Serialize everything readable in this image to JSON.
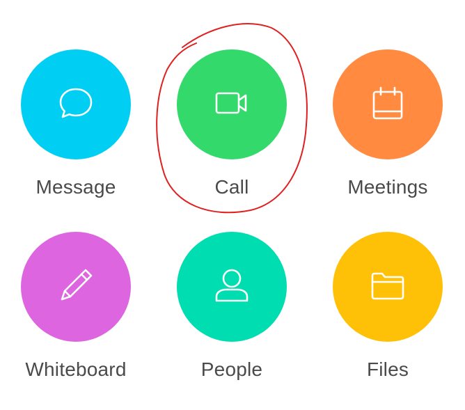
{
  "tiles": [
    {
      "label": "Message",
      "icon": "chat-bubble-icon",
      "color": "#00CFF3"
    },
    {
      "label": "Call",
      "icon": "video-camera-icon",
      "color": "#34D96B"
    },
    {
      "label": "Meetings",
      "icon": "calendar-icon",
      "color": "#FF8A40"
    },
    {
      "label": "Whiteboard",
      "icon": "pencil-icon",
      "color": "#DD66E0"
    },
    {
      "label": "People",
      "icon": "person-icon",
      "color": "#00DDB1"
    },
    {
      "label": "Files",
      "icon": "folder-icon",
      "color": "#FFC107"
    }
  ],
  "annotation": {
    "color": "#E02020",
    "target": "Call"
  }
}
